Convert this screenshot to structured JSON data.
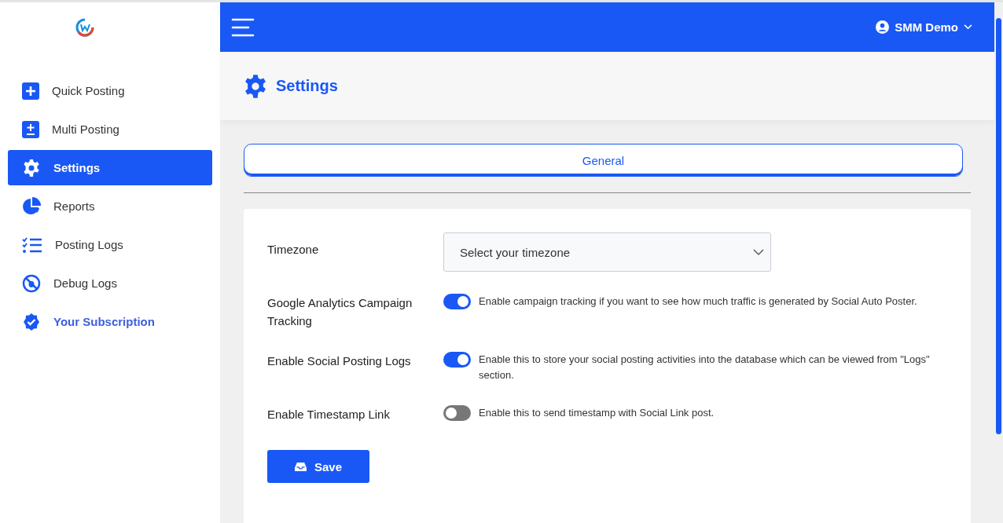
{
  "sidebar": {
    "items": [
      {
        "label": "Quick Posting",
        "selected": false,
        "kind": "nav"
      },
      {
        "label": "Multi Posting",
        "selected": false,
        "kind": "nav"
      },
      {
        "label": "Settings",
        "selected": true,
        "kind": "nav"
      },
      {
        "label": "Reports",
        "selected": false,
        "kind": "nav"
      },
      {
        "label": "Posting Logs",
        "selected": false,
        "kind": "nav"
      },
      {
        "label": "Debug Logs",
        "selected": false,
        "kind": "nav"
      },
      {
        "label": "Your Subscription",
        "selected": false,
        "kind": "accent"
      }
    ]
  },
  "topbar": {
    "user": "SMM Demo"
  },
  "page": {
    "title": "Settings"
  },
  "tabs": [
    {
      "label": "General",
      "selected": true
    }
  ],
  "settings": [
    {
      "kind": "select",
      "label": "Timezone",
      "placeholder": "Select your timezone"
    },
    {
      "kind": "toggle",
      "label": "Google Analytics Campaign Tracking",
      "on": true,
      "description": "Enable campaign tracking if you want to see how much traffic is generated by Social Auto Poster."
    },
    {
      "kind": "toggle",
      "label": "Enable Social Posting Logs",
      "on": true,
      "description": "Enable this to store your social posting activities into the database which can be viewed from \"Logs\" section."
    },
    {
      "kind": "toggle",
      "label": "Enable Timestamp Link",
      "on": false,
      "description": "Enable this to send timestamp with Social Link post."
    }
  ],
  "save_button": "Save"
}
